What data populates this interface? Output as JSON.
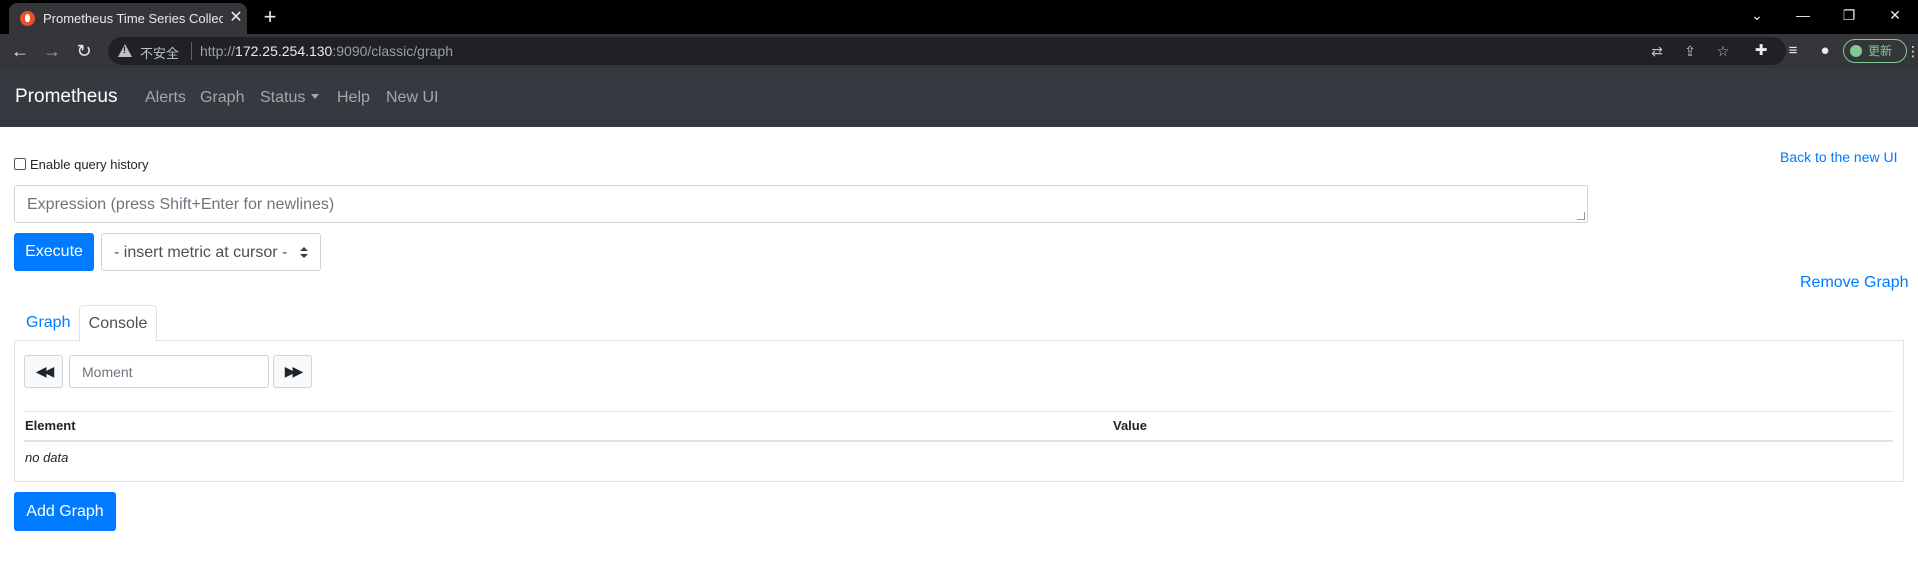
{
  "browser": {
    "tab_title": "Prometheus Time Series Collec",
    "url_scheme": "http://",
    "url_host": "172.25.254.130",
    "url_rest": ":9090/classic/graph",
    "security_label": "不安全",
    "update_label": "更新"
  },
  "navbar": {
    "brand": "Prometheus",
    "links": [
      "Alerts",
      "Graph",
      "Status",
      "Help",
      "New UI"
    ]
  },
  "controls": {
    "history_label": "Enable query history",
    "back_link": "Back to the new UI",
    "expression_placeholder": "Expression (press Shift+Enter for newlines)",
    "execute_label": "Execute",
    "metric_select_value": "- insert metric at cursor -",
    "remove_graph_label": "Remove Graph"
  },
  "tabs": {
    "graph": "Graph",
    "console": "Console",
    "active": "Console"
  },
  "console": {
    "moment_placeholder": "Moment",
    "columns": [
      "Element",
      "Value"
    ],
    "empty_text": "no data"
  },
  "add_graph_label": "Add Graph",
  "colors": {
    "navbar_bg": "#343a40",
    "primary": "#007bff"
  }
}
